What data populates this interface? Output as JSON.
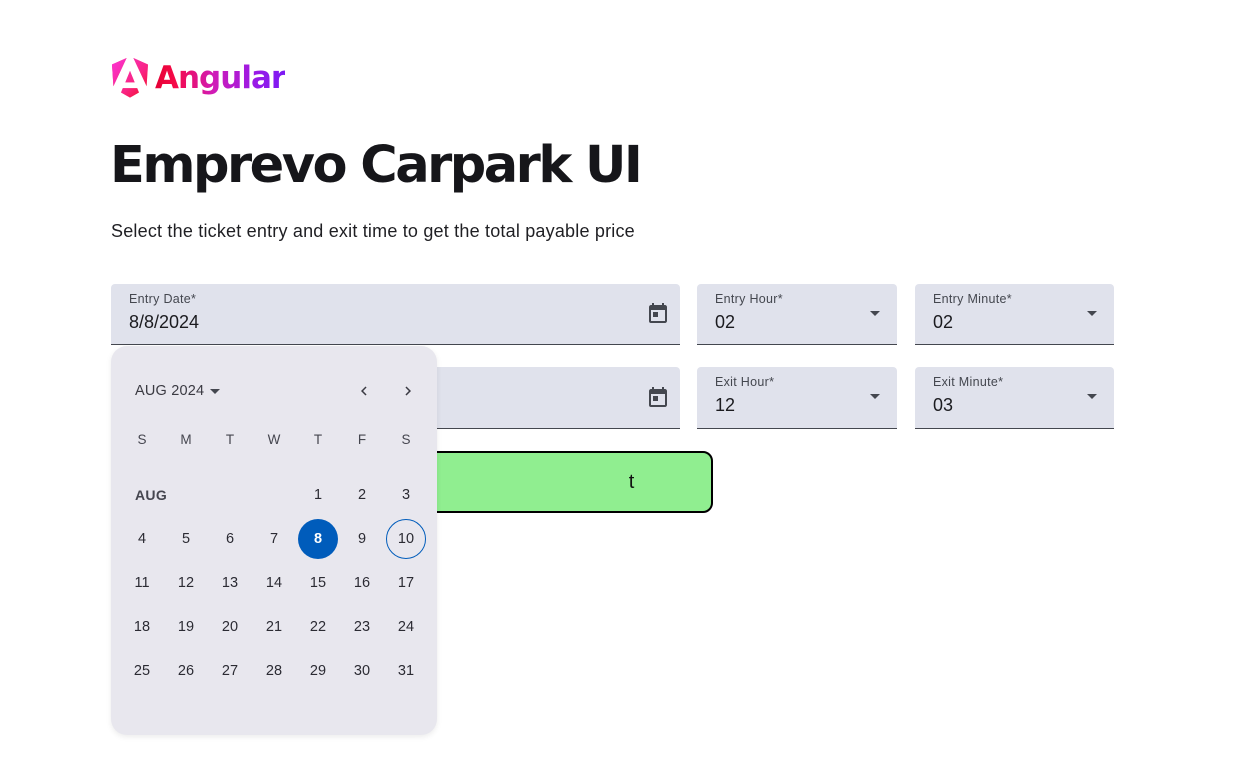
{
  "brand": {
    "name": "Angular",
    "logo_icon": "angular-shield-icon"
  },
  "header": {
    "title": "Emprevo Carpark UI",
    "subtitle": "Select the ticket entry and exit time to get the total payable price"
  },
  "form": {
    "entry_date": {
      "label": "Entry Date*",
      "value": "8/8/2024",
      "icon": "calendar-icon"
    },
    "entry_hour": {
      "label": "Entry Hour*",
      "value": "02"
    },
    "entry_minute": {
      "label": "Entry Minute*",
      "value": "02"
    },
    "exit_date": {
      "icon": "calendar-icon"
    },
    "exit_hour": {
      "label": "Exit Hour*",
      "value": "12"
    },
    "exit_minute": {
      "label": "Exit Minute*",
      "value": "03"
    },
    "submit_label": "t"
  },
  "calendar": {
    "period": "AUG 2024",
    "month_label": "AUG",
    "weekdays": [
      "S",
      "M",
      "T",
      "W",
      "T",
      "F",
      "S"
    ],
    "first_weekday_index": 4,
    "days_in_month": 31,
    "selected_day": 8,
    "today_day": 10,
    "accent": "#005cbb"
  },
  "colors": {
    "field_bg": "#e0e2ec",
    "calendar_bg": "#e8e7ee",
    "submit_bg": "#90ee90"
  }
}
